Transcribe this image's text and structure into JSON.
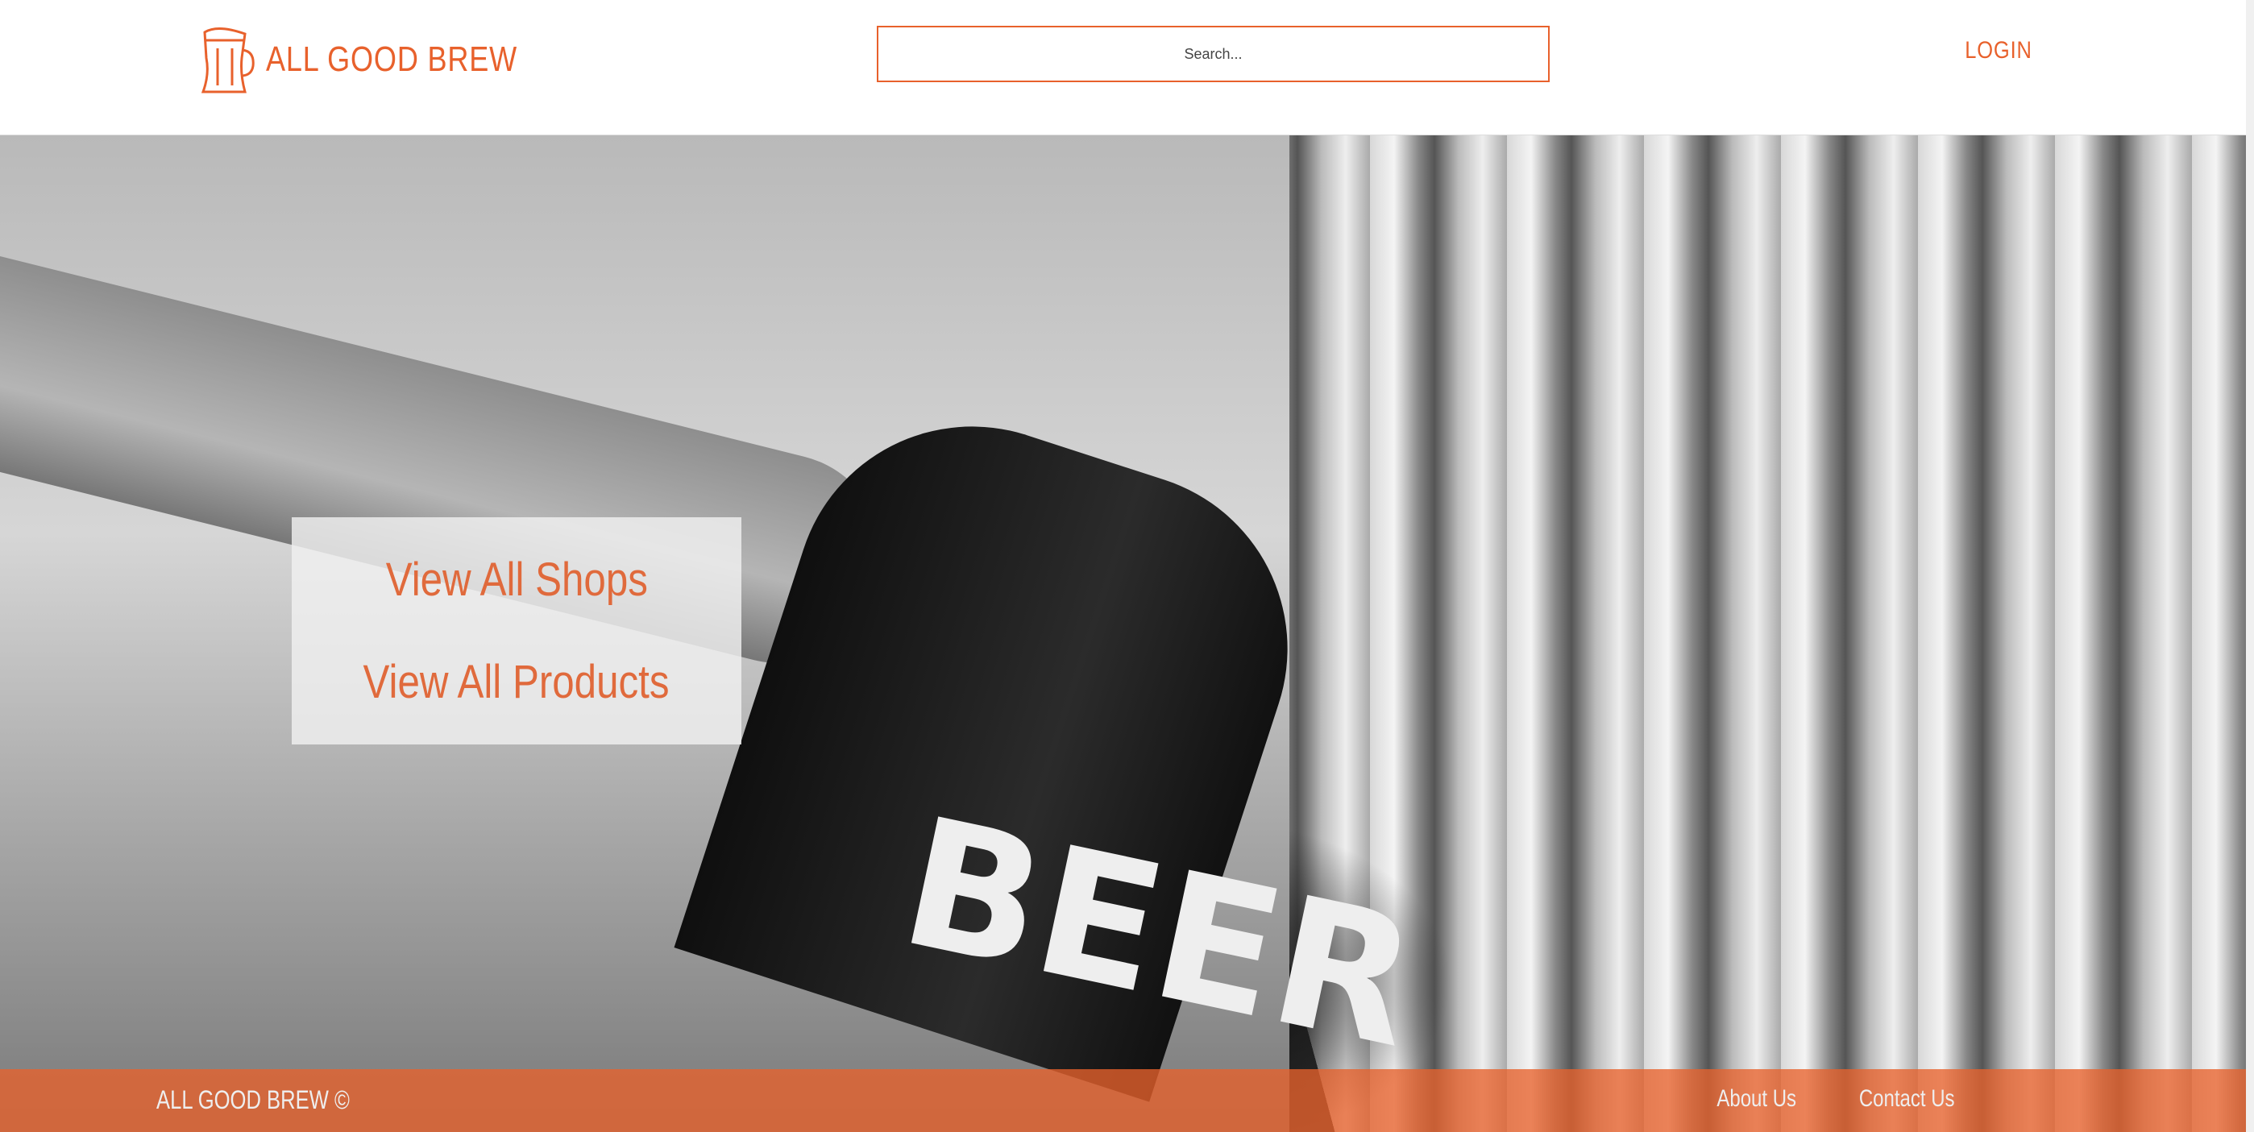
{
  "header": {
    "brand": "ALL GOOD BREW",
    "search_placeholder": "Search...",
    "login": "LOGIN"
  },
  "hero": {
    "bottle_text": "BEER",
    "menu": [
      "View All Shops",
      "View All Products"
    ]
  },
  "footer": {
    "brand": "ALL GOOD BREW ©",
    "links": [
      "About Us",
      "Contact Us"
    ]
  },
  "colors": {
    "accent": "#e8612c"
  }
}
